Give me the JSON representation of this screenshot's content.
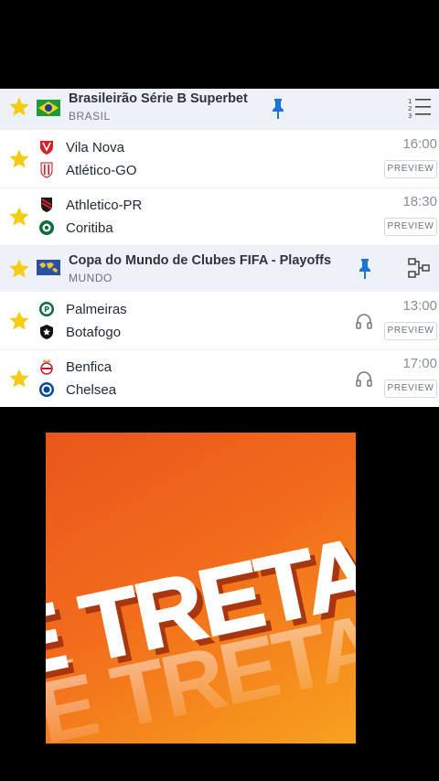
{
  "leagues": [
    {
      "name": "Brasileirão Série B Superbet",
      "country": "BRASIL",
      "flag": "brazil-flag",
      "action_icon": "standings-list-icon",
      "matches": [
        {
          "home": "Vila Nova",
          "away": "Atlético-GO",
          "time": "16:00",
          "preview": "PREVIEW",
          "audio": false
        },
        {
          "home": "Athletico-PR",
          "away": "Coritiba",
          "time": "18:30",
          "preview": "PREVIEW",
          "audio": false
        }
      ]
    },
    {
      "name": "Copa do Mundo de Clubes FIFA - Playoffs",
      "country": "MUNDO",
      "flag": "world-flag",
      "action_icon": "bracket-icon",
      "matches": [
        {
          "home": "Palmeiras",
          "away": "Botafogo",
          "time": "13:00",
          "preview": "PREVIEW",
          "audio": true
        },
        {
          "home": "Benfica",
          "away": "Chelsea",
          "time": "17:00",
          "preview": "PREVIEW",
          "audio": true
        }
      ]
    }
  ],
  "promo": {
    "text": "É TRETA!"
  },
  "colors": {
    "star": "#f5cc14",
    "pin": "#1b74d6",
    "promo_orange": "#ee6a1d",
    "row_header_bg": "#eef1f7"
  }
}
